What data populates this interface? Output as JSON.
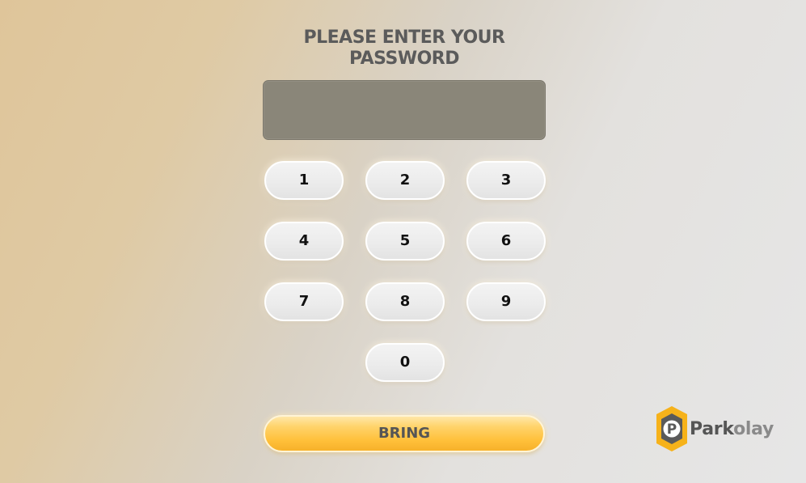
{
  "prompt": {
    "line1": "PLEASE ENTER YOUR",
    "line2": "PASSWORD"
  },
  "password_display": {
    "value": ""
  },
  "keypad": {
    "keys": [
      "1",
      "2",
      "3",
      "4",
      "5",
      "6",
      "7",
      "8",
      "9",
      "0"
    ]
  },
  "submit": {
    "label": "BRING"
  },
  "brand": {
    "logo_letter": "P",
    "name_part1": "Park",
    "name_part2": "olay",
    "colors": {
      "accent_yellow": "#f6b21a",
      "dark": "#555555",
      "display_bg": "#8a8679"
    }
  }
}
